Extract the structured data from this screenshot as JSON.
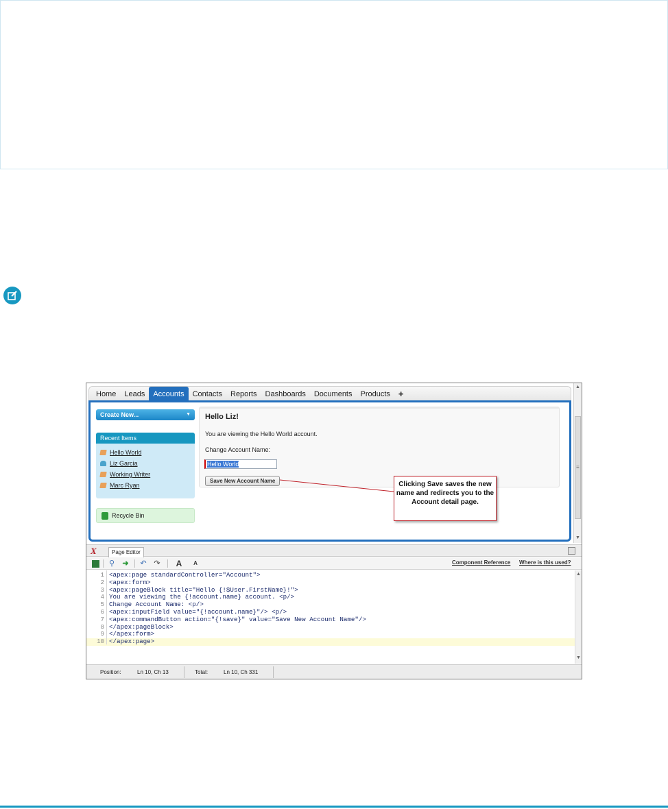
{
  "browser": {
    "tabs": [
      {
        "label": "Home"
      },
      {
        "label": "Leads"
      },
      {
        "label": "Accounts"
      },
      {
        "label": "Contacts"
      },
      {
        "label": "Reports"
      },
      {
        "label": "Dashboards"
      },
      {
        "label": "Documents"
      },
      {
        "label": "Products"
      },
      {
        "label": "+"
      }
    ],
    "active_tab": "Accounts",
    "accent_color": "#236fbd"
  },
  "sidebar": {
    "create_new_label": "Create New...",
    "recent_items_title": "Recent Items",
    "recent_items": [
      {
        "label": "Hello World",
        "icon": "account-icon"
      },
      {
        "label": "Liz Garcia",
        "icon": "contact-icon"
      },
      {
        "label": "Working Writer",
        "icon": "account-icon"
      },
      {
        "label": "Marc Ryan",
        "icon": "account-icon"
      }
    ],
    "recycle_bin_label": "Recycle Bin"
  },
  "page_block": {
    "title": "Hello Liz!",
    "viewing_text": "You are viewing the Hello World account.",
    "change_label": "Change Account Name:",
    "input_value": "Hello World",
    "save_button_label": "Save New Account Name"
  },
  "callout": {
    "text": "Clicking Save saves the new name and redirects you to the Account detail page."
  },
  "editor": {
    "tab_label": "Page Editor",
    "links": {
      "component_reference": "Component Reference",
      "where_used": "Where is this used?"
    },
    "code_lines": [
      "<apex:page standardController=\"Account\">",
      "<apex:form>",
      "<apex:pageBlock title=\"Hello {!$User.FirstName}!\">",
      "You are viewing the {!account.name} account. <p/>",
      "Change Account Name: <p/>",
      "<apex:inputField value=\"{!account.name}\"/> <p/>",
      "<apex:commandButton action=\"{!save}\" value=\"Save New Account Name\"/>",
      "</apex:pageBlock>",
      "</apex:form>",
      "</apex:page>"
    ],
    "line_numbers": [
      "1",
      "2",
      "3",
      "4",
      "5",
      "6",
      "7",
      "8",
      "9",
      "10"
    ],
    "status": {
      "position_label": "Position:",
      "position_value": "Ln 10, Ch 13",
      "total_label": "Total:",
      "total_value": "Ln 10, Ch 331"
    }
  }
}
